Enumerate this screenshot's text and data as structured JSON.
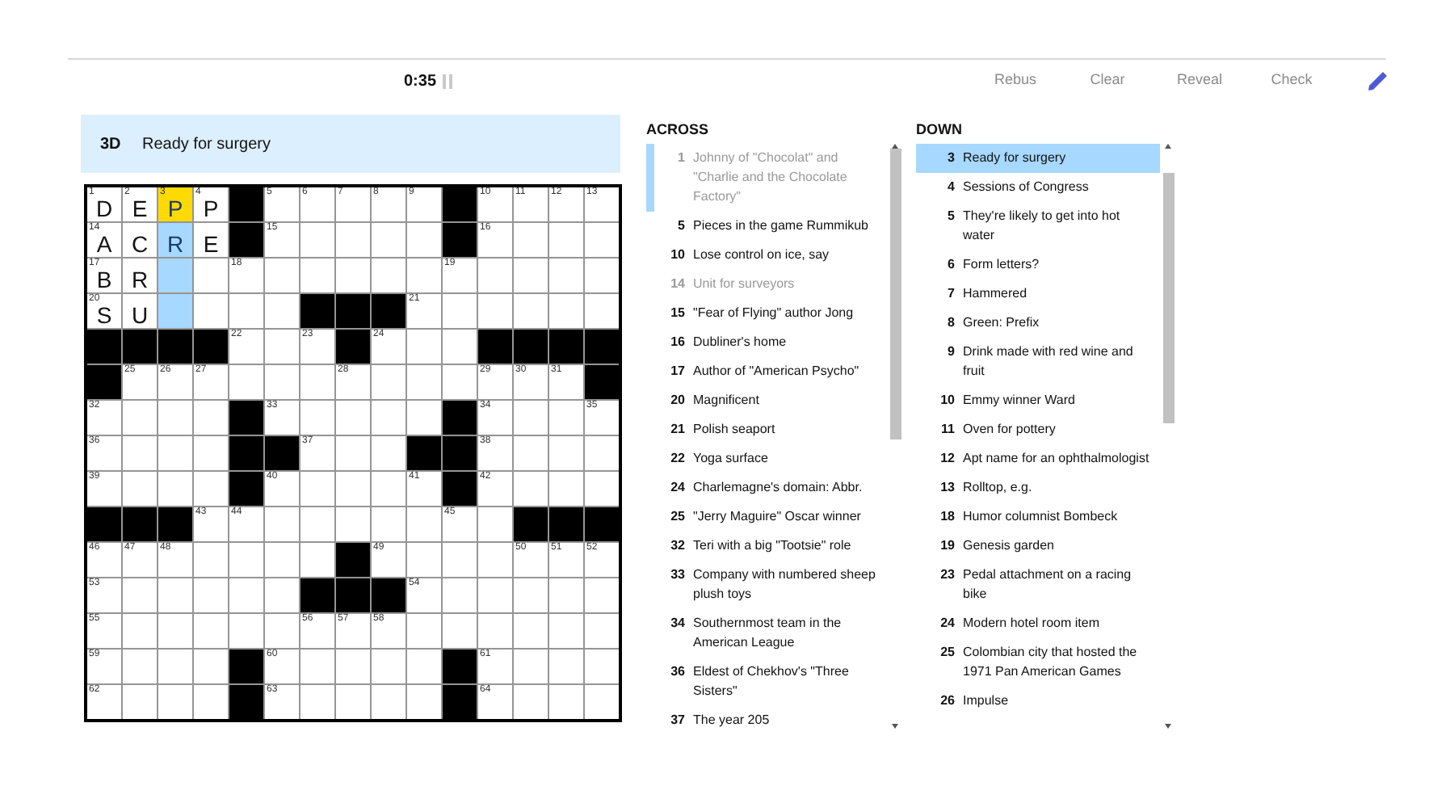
{
  "toolbar": {
    "timer": "0:35",
    "buttons": [
      "Rebus",
      "Clear",
      "Reveal",
      "Check"
    ]
  },
  "current_clue": {
    "label": "3D",
    "text": "Ready for surgery"
  },
  "grid": [
    [
      {
        "block": false,
        "number": "1",
        "letter": "D",
        "selected": false,
        "in_word": false
      },
      {
        "block": false,
        "number": "2",
        "letter": "E",
        "selected": false,
        "in_word": false
      },
      {
        "block": false,
        "number": "3",
        "letter": "P",
        "selected": true,
        "in_word": true
      },
      {
        "block": false,
        "number": "4",
        "letter": "P",
        "selected": false,
        "in_word": false
      },
      {
        "block": true
      },
      {
        "block": false,
        "number": "5",
        "selected": false,
        "in_word": false
      },
      {
        "block": false,
        "number": "6",
        "selected": false,
        "in_word": false
      },
      {
        "block": false,
        "number": "7",
        "selected": false,
        "in_word": false
      },
      {
        "block": false,
        "number": "8",
        "selected": false,
        "in_word": false
      },
      {
        "block": false,
        "number": "9",
        "selected": false,
        "in_word": false
      },
      {
        "block": true
      },
      {
        "block": false,
        "number": "10",
        "selected": false,
        "in_word": false
      },
      {
        "block": false,
        "number": "11",
        "selected": false,
        "in_word": false
      },
      {
        "block": false,
        "number": "12",
        "selected": false,
        "in_word": false
      },
      {
        "block": false,
        "number": "13",
        "selected": false,
        "in_word": false
      }
    ],
    [
      {
        "block": false,
        "number": "14",
        "letter": "A",
        "selected": false,
        "in_word": false
      },
      {
        "block": false,
        "letter": "C",
        "selected": false,
        "in_word": false
      },
      {
        "block": false,
        "letter": "R",
        "selected": false,
        "in_word": true
      },
      {
        "block": false,
        "letter": "E",
        "selected": false,
        "in_word": false
      },
      {
        "block": true
      },
      {
        "block": false,
        "number": "15",
        "selected": false,
        "in_word": false
      },
      {
        "block": false,
        "selected": false,
        "in_word": false
      },
      {
        "block": false,
        "selected": false,
        "in_word": false
      },
      {
        "block": false,
        "selected": false,
        "in_word": false
      },
      {
        "block": false,
        "selected": false,
        "in_word": false
      },
      {
        "block": true
      },
      {
        "block": false,
        "number": "16",
        "selected": false,
        "in_word": false
      },
      {
        "block": false,
        "selected": false,
        "in_word": false
      },
      {
        "block": false,
        "selected": false,
        "in_word": false
      },
      {
        "block": false,
        "selected": false,
        "in_word": false
      }
    ],
    [
      {
        "block": false,
        "number": "17",
        "letter": "B",
        "selected": false,
        "in_word": false
      },
      {
        "block": false,
        "letter": "R",
        "selected": false,
        "in_word": false
      },
      {
        "block": false,
        "selected": false,
        "in_word": true
      },
      {
        "block": false,
        "selected": false,
        "in_word": false
      },
      {
        "block": false,
        "number": "18",
        "selected": false,
        "in_word": false
      },
      {
        "block": false,
        "selected": false,
        "in_word": false
      },
      {
        "block": false,
        "selected": false,
        "in_word": false
      },
      {
        "block": false,
        "selected": false,
        "in_word": false
      },
      {
        "block": false,
        "selected": false,
        "in_word": false
      },
      {
        "block": false,
        "selected": false,
        "in_word": false
      },
      {
        "block": false,
        "number": "19",
        "selected": false,
        "in_word": false
      },
      {
        "block": false,
        "selected": false,
        "in_word": false
      },
      {
        "block": false,
        "selected": false,
        "in_word": false
      },
      {
        "block": false,
        "selected": false,
        "in_word": false
      },
      {
        "block": false,
        "selected": false,
        "in_word": false
      }
    ],
    [
      {
        "block": false,
        "number": "20",
        "letter": "S",
        "selected": false,
        "in_word": false
      },
      {
        "block": false,
        "letter": "U",
        "selected": false,
        "in_word": false
      },
      {
        "block": false,
        "selected": false,
        "in_word": true
      },
      {
        "block": false,
        "selected": false,
        "in_word": false
      },
      {
        "block": false,
        "selected": false,
        "in_word": false
      },
      {
        "block": false,
        "selected": false,
        "in_word": false
      },
      {
        "block": true
      },
      {
        "block": true
      },
      {
        "block": true
      },
      {
        "block": false,
        "number": "21",
        "selected": false,
        "in_word": false
      },
      {
        "block": false,
        "selected": false,
        "in_word": false
      },
      {
        "block": false,
        "selected": false,
        "in_word": false
      },
      {
        "block": false,
        "selected": false,
        "in_word": false
      },
      {
        "block": false,
        "selected": false,
        "in_word": false
      },
      {
        "block": false,
        "selected": false,
        "in_word": false
      }
    ],
    [
      {
        "block": true
      },
      {
        "block": true
      },
      {
        "block": true
      },
      {
        "block": true
      },
      {
        "block": false,
        "number": "22",
        "selected": false,
        "in_word": false
      },
      {
        "block": false,
        "selected": false,
        "in_word": false
      },
      {
        "block": false,
        "number": "23",
        "selected": false,
        "in_word": false
      },
      {
        "block": true
      },
      {
        "block": false,
        "number": "24",
        "selected": false,
        "in_word": false
      },
      {
        "block": false,
        "selected": false,
        "in_word": false
      },
      {
        "block": false,
        "selected": false,
        "in_word": false
      },
      {
        "block": true
      },
      {
        "block": true
      },
      {
        "block": true
      },
      {
        "block": true
      }
    ],
    [
      {
        "block": true
      },
      {
        "block": false,
        "number": "25",
        "selected": false,
        "in_word": false
      },
      {
        "block": false,
        "number": "26",
        "selected": false,
        "in_word": false
      },
      {
        "block": false,
        "number": "27",
        "selected": false,
        "in_word": false
      },
      {
        "block": false,
        "selected": false,
        "in_word": false
      },
      {
        "block": false,
        "selected": false,
        "in_word": false
      },
      {
        "block": false,
        "selected": false,
        "in_word": false
      },
      {
        "block": false,
        "number": "28",
        "selected": false,
        "in_word": false
      },
      {
        "block": false,
        "selected": false,
        "in_word": false
      },
      {
        "block": false,
        "selected": false,
        "in_word": false
      },
      {
        "block": false,
        "selected": false,
        "in_word": false
      },
      {
        "block": false,
        "number": "29",
        "selected": false,
        "in_word": false
      },
      {
        "block": false,
        "number": "30",
        "selected": false,
        "in_word": false
      },
      {
        "block": false,
        "number": "31",
        "selected": false,
        "in_word": false
      },
      {
        "block": true
      }
    ],
    [
      {
        "block": false,
        "number": "32",
        "selected": false,
        "in_word": false
      },
      {
        "block": false,
        "selected": false,
        "in_word": false
      },
      {
        "block": false,
        "selected": false,
        "in_word": false
      },
      {
        "block": false,
        "selected": false,
        "in_word": false
      },
      {
        "block": true
      },
      {
        "block": false,
        "number": "33",
        "selected": false,
        "in_word": false
      },
      {
        "block": false,
        "selected": false,
        "in_word": false
      },
      {
        "block": false,
        "selected": false,
        "in_word": false
      },
      {
        "block": false,
        "selected": false,
        "in_word": false
      },
      {
        "block": false,
        "selected": false,
        "in_word": false
      },
      {
        "block": true
      },
      {
        "block": false,
        "number": "34",
        "selected": false,
        "in_word": false
      },
      {
        "block": false,
        "selected": false,
        "in_word": false
      },
      {
        "block": false,
        "selected": false,
        "in_word": false
      },
      {
        "block": false,
        "number": "35",
        "selected": false,
        "in_word": false
      }
    ],
    [
      {
        "block": false,
        "number": "36",
        "selected": false,
        "in_word": false
      },
      {
        "block": false,
        "selected": false,
        "in_word": false
      },
      {
        "block": false,
        "selected": false,
        "in_word": false
      },
      {
        "block": false,
        "selected": false,
        "in_word": false
      },
      {
        "block": true
      },
      {
        "block": true
      },
      {
        "block": false,
        "number": "37",
        "selected": false,
        "in_word": false
      },
      {
        "block": false,
        "selected": false,
        "in_word": false
      },
      {
        "block": false,
        "selected": false,
        "in_word": false
      },
      {
        "block": true
      },
      {
        "block": true
      },
      {
        "block": false,
        "number": "38",
        "selected": false,
        "in_word": false
      },
      {
        "block": false,
        "selected": false,
        "in_word": false
      },
      {
        "block": false,
        "selected": false,
        "in_word": false
      },
      {
        "block": false,
        "selected": false,
        "in_word": false
      }
    ],
    [
      {
        "block": false,
        "number": "39",
        "selected": false,
        "in_word": false
      },
      {
        "block": false,
        "selected": false,
        "in_word": false
      },
      {
        "block": false,
        "selected": false,
        "in_word": false
      },
      {
        "block": false,
        "selected": false,
        "in_word": false
      },
      {
        "block": true
      },
      {
        "block": false,
        "number": "40",
        "selected": false,
        "in_word": false
      },
      {
        "block": false,
        "selected": false,
        "in_word": false
      },
      {
        "block": false,
        "selected": false,
        "in_word": false
      },
      {
        "block": false,
        "selected": false,
        "in_word": false
      },
      {
        "block": false,
        "number": "41",
        "selected": false,
        "in_word": false
      },
      {
        "block": true
      },
      {
        "block": false,
        "number": "42",
        "selected": false,
        "in_word": false
      },
      {
        "block": false,
        "selected": false,
        "in_word": false
      },
      {
        "block": false,
        "selected": false,
        "in_word": false
      },
      {
        "block": false,
        "selected": false,
        "in_word": false
      }
    ],
    [
      {
        "block": true
      },
      {
        "block": true
      },
      {
        "block": true
      },
      {
        "block": false,
        "number": "43",
        "selected": false,
        "in_word": false
      },
      {
        "block": false,
        "number": "44",
        "selected": false,
        "in_word": false
      },
      {
        "block": false,
        "selected": false,
        "in_word": false
      },
      {
        "block": false,
        "selected": false,
        "in_word": false
      },
      {
        "block": false,
        "selected": false,
        "in_word": false
      },
      {
        "block": false,
        "selected": false,
        "in_word": false
      },
      {
        "block": false,
        "selected": false,
        "in_word": false
      },
      {
        "block": false,
        "number": "45",
        "selected": false,
        "in_word": false
      },
      {
        "block": false,
        "selected": false,
        "in_word": false
      },
      {
        "block": true
      },
      {
        "block": true
      },
      {
        "block": true
      }
    ],
    [
      {
        "block": false,
        "number": "46",
        "selected": false,
        "in_word": false
      },
      {
        "block": false,
        "number": "47",
        "selected": false,
        "in_word": false
      },
      {
        "block": false,
        "number": "48",
        "selected": false,
        "in_word": false
      },
      {
        "block": false,
        "selected": false,
        "in_word": false
      },
      {
        "block": false,
        "selected": false,
        "in_word": false
      },
      {
        "block": false,
        "selected": false,
        "in_word": false
      },
      {
        "block": false,
        "selected": false,
        "in_word": false
      },
      {
        "block": true
      },
      {
        "block": false,
        "number": "49",
        "selected": false,
        "in_word": false
      },
      {
        "block": false,
        "selected": false,
        "in_word": false
      },
      {
        "block": false,
        "selected": false,
        "in_word": false
      },
      {
        "block": false,
        "selected": false,
        "in_word": false
      },
      {
        "block": false,
        "number": "50",
        "selected": false,
        "in_word": false
      },
      {
        "block": false,
        "number": "51",
        "selected": false,
        "in_word": false
      },
      {
        "block": false,
        "number": "52",
        "selected": false,
        "in_word": false
      }
    ],
    [
      {
        "block": false,
        "number": "53",
        "selected": false,
        "in_word": false
      },
      {
        "block": false,
        "selected": false,
        "in_word": false
      },
      {
        "block": false,
        "selected": false,
        "in_word": false
      },
      {
        "block": false,
        "selected": false,
        "in_word": false
      },
      {
        "block": false,
        "selected": false,
        "in_word": false
      },
      {
        "block": false,
        "selected": false,
        "in_word": false
      },
      {
        "block": true
      },
      {
        "block": true
      },
      {
        "block": true
      },
      {
        "block": false,
        "number": "54",
        "selected": false,
        "in_word": false
      },
      {
        "block": false,
        "selected": false,
        "in_word": false
      },
      {
        "block": false,
        "selected": false,
        "in_word": false
      },
      {
        "block": false,
        "selected": false,
        "in_word": false
      },
      {
        "block": false,
        "selected": false,
        "in_word": false
      },
      {
        "block": false,
        "selected": false,
        "in_word": false
      }
    ],
    [
      {
        "block": false,
        "number": "55",
        "selected": false,
        "in_word": false
      },
      {
        "block": false,
        "selected": false,
        "in_word": false
      },
      {
        "block": false,
        "selected": false,
        "in_word": false
      },
      {
        "block": false,
        "selected": false,
        "in_word": false
      },
      {
        "block": false,
        "selected": false,
        "in_word": false
      },
      {
        "block": false,
        "selected": false,
        "in_word": false
      },
      {
        "block": false,
        "number": "56",
        "selected": false,
        "in_word": false
      },
      {
        "block": false,
        "number": "57",
        "selected": false,
        "in_word": false
      },
      {
        "block": false,
        "number": "58",
        "selected": false,
        "in_word": false
      },
      {
        "block": false,
        "selected": false,
        "in_word": false
      },
      {
        "block": false,
        "selected": false,
        "in_word": false
      },
      {
        "block": false,
        "selected": false,
        "in_word": false
      },
      {
        "block": false,
        "selected": false,
        "in_word": false
      },
      {
        "block": false,
        "selected": false,
        "in_word": false
      },
      {
        "block": false,
        "selected": false,
        "in_word": false
      }
    ],
    [
      {
        "block": false,
        "number": "59",
        "selected": false,
        "in_word": false
      },
      {
        "block": false,
        "selected": false,
        "in_word": false
      },
      {
        "block": false,
        "selected": false,
        "in_word": false
      },
      {
        "block": false,
        "selected": false,
        "in_word": false
      },
      {
        "block": true
      },
      {
        "block": false,
        "number": "60",
        "selected": false,
        "in_word": false
      },
      {
        "block": false,
        "selected": false,
        "in_word": false
      },
      {
        "block": false,
        "selected": false,
        "in_word": false
      },
      {
        "block": false,
        "selected": false,
        "in_word": false
      },
      {
        "block": false,
        "selected": false,
        "in_word": false
      },
      {
        "block": true
      },
      {
        "block": false,
        "number": "61",
        "selected": false,
        "in_word": false
      },
      {
        "block": false,
        "selected": false,
        "in_word": false
      },
      {
        "block": false,
        "selected": false,
        "in_word": false
      },
      {
        "block": false,
        "selected": false,
        "in_word": false
      }
    ],
    [
      {
        "block": false,
        "number": "62",
        "selected": false,
        "in_word": false
      },
      {
        "block": false,
        "selected": false,
        "in_word": false
      },
      {
        "block": false,
        "selected": false,
        "in_word": false
      },
      {
        "block": false,
        "selected": false,
        "in_word": false
      },
      {
        "block": true
      },
      {
        "block": false,
        "number": "63",
        "selected": false,
        "in_word": false
      },
      {
        "block": false,
        "selected": false,
        "in_word": false
      },
      {
        "block": false,
        "selected": false,
        "in_word": false
      },
      {
        "block": false,
        "selected": false,
        "in_word": false
      },
      {
        "block": false,
        "selected": false,
        "in_word": false
      },
      {
        "block": true
      },
      {
        "block": false,
        "number": "64",
        "selected": false,
        "in_word": false
      },
      {
        "block": false,
        "selected": false,
        "in_word": false
      },
      {
        "block": false,
        "selected": false,
        "in_word": false
      },
      {
        "block": false,
        "selected": false,
        "in_word": false
      }
    ]
  ],
  "across": {
    "title": "ACROSS",
    "clues": [
      {
        "number": "1",
        "text": "Johnny of \"Chocolat\" and \"Charlie and the Chocolate Factory\"",
        "selected": false,
        "crossing": true,
        "completed": true
      },
      {
        "number": "5",
        "text": "Pieces in the game Rummikub",
        "selected": false,
        "crossing": false,
        "completed": false
      },
      {
        "number": "10",
        "text": "Lose control on ice, say",
        "selected": false,
        "crossing": false,
        "completed": false
      },
      {
        "number": "14",
        "text": "Unit for surveyors",
        "selected": false,
        "crossing": false,
        "completed": true
      },
      {
        "number": "15",
        "text": "\"Fear of Flying\" author Jong",
        "selected": false,
        "crossing": false,
        "completed": false
      },
      {
        "number": "16",
        "text": "Dubliner's home",
        "selected": false,
        "crossing": false,
        "completed": false
      },
      {
        "number": "17",
        "text": "Author of \"American Psycho\"",
        "selected": false,
        "crossing": false,
        "completed": false
      },
      {
        "number": "20",
        "text": "Magnificent",
        "selected": false,
        "crossing": false,
        "completed": false
      },
      {
        "number": "21",
        "text": "Polish seaport",
        "selected": false,
        "crossing": false,
        "completed": false
      },
      {
        "number": "22",
        "text": "Yoga surface",
        "selected": false,
        "crossing": false,
        "completed": false
      },
      {
        "number": "24",
        "text": "Charlemagne's domain: Abbr.",
        "selected": false,
        "crossing": false,
        "completed": false
      },
      {
        "number": "25",
        "text": "\"Jerry Maguire\" Oscar winner",
        "selected": false,
        "crossing": false,
        "completed": false
      },
      {
        "number": "32",
        "text": "Teri with a big \"Tootsie\" role",
        "selected": false,
        "crossing": false,
        "completed": false
      },
      {
        "number": "33",
        "text": "Company with numbered sheep plush toys",
        "selected": false,
        "crossing": false,
        "completed": false
      },
      {
        "number": "34",
        "text": "Southernmost team in the American League",
        "selected": false,
        "crossing": false,
        "completed": false
      },
      {
        "number": "36",
        "text": "Eldest of Chekhov's \"Three Sisters\"",
        "selected": false,
        "crossing": false,
        "completed": false
      },
      {
        "number": "37",
        "text": "The year 205",
        "selected": false,
        "crossing": false,
        "completed": false
      }
    ]
  },
  "down": {
    "title": "DOWN",
    "clues": [
      {
        "number": "3",
        "text": "Ready for surgery",
        "selected": true,
        "crossing": false,
        "completed": false
      },
      {
        "number": "4",
        "text": "Sessions of Congress",
        "selected": false,
        "crossing": false,
        "completed": false
      },
      {
        "number": "5",
        "text": "They're likely to get into hot water",
        "selected": false,
        "crossing": false,
        "completed": false
      },
      {
        "number": "6",
        "text": "Form letters?",
        "selected": false,
        "crossing": false,
        "completed": false
      },
      {
        "number": "7",
        "text": "Hammered",
        "selected": false,
        "crossing": false,
        "completed": false
      },
      {
        "number": "8",
        "text": "Green: Prefix",
        "selected": false,
        "crossing": false,
        "completed": false
      },
      {
        "number": "9",
        "text": "Drink made with red wine and fruit",
        "selected": false,
        "crossing": false,
        "completed": false
      },
      {
        "number": "10",
        "text": "Emmy winner Ward",
        "selected": false,
        "crossing": false,
        "completed": false
      },
      {
        "number": "11",
        "text": "Oven for pottery",
        "selected": false,
        "crossing": false,
        "completed": false
      },
      {
        "number": "12",
        "text": "Apt name for an ophthalmologist",
        "selected": false,
        "crossing": false,
        "completed": false
      },
      {
        "number": "13",
        "text": "Rolltop, e.g.",
        "selected": false,
        "crossing": false,
        "completed": false
      },
      {
        "number": "18",
        "text": "Humor columnist Bombeck",
        "selected": false,
        "crossing": false,
        "completed": false
      },
      {
        "number": "19",
        "text": "Genesis garden",
        "selected": false,
        "crossing": false,
        "completed": false
      },
      {
        "number": "23",
        "text": "Pedal attachment on a racing bike",
        "selected": false,
        "crossing": false,
        "completed": false
      },
      {
        "number": "24",
        "text": "Modern hotel room item",
        "selected": false,
        "crossing": false,
        "completed": false
      },
      {
        "number": "25",
        "text": "Colombian city that hosted the 1971 Pan American Games",
        "selected": false,
        "crossing": false,
        "completed": false
      },
      {
        "number": "26",
        "text": "Impulse",
        "selected": false,
        "crossing": false,
        "completed": false
      }
    ]
  }
}
